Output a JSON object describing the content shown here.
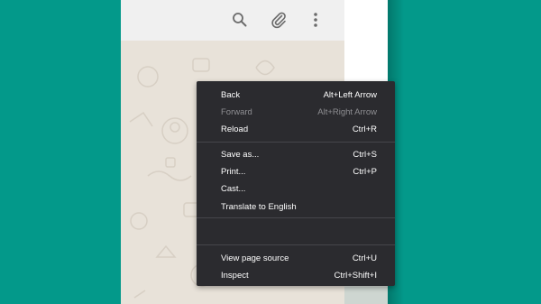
{
  "toolbar": {
    "icons": [
      "search-icon",
      "paperclip-icon",
      "more-vertical-icon"
    ]
  },
  "context_menu": {
    "items": [
      {
        "label": "Back",
        "shortcut": "Alt+Left Arrow",
        "enabled": true
      },
      {
        "label": "Forward",
        "shortcut": "Alt+Right Arrow",
        "enabled": false
      },
      {
        "label": "Reload",
        "shortcut": "Ctrl+R",
        "enabled": true
      },
      {
        "label": "Save as...",
        "shortcut": "Ctrl+S",
        "enabled": true
      },
      {
        "label": "Print...",
        "shortcut": "Ctrl+P",
        "enabled": true
      },
      {
        "label": "Cast...",
        "shortcut": "",
        "enabled": true
      },
      {
        "label": "Translate to English",
        "shortcut": "",
        "enabled": true
      },
      {
        "label": "View page source",
        "shortcut": "Ctrl+U",
        "enabled": true
      },
      {
        "label": "Inspect",
        "shortcut": "Ctrl+Shift+I",
        "enabled": true
      }
    ]
  },
  "colors": {
    "desktop_bg": "#03998a",
    "menu_bg": "#2b2b2f",
    "chat_bg": "#e8e2d9"
  }
}
